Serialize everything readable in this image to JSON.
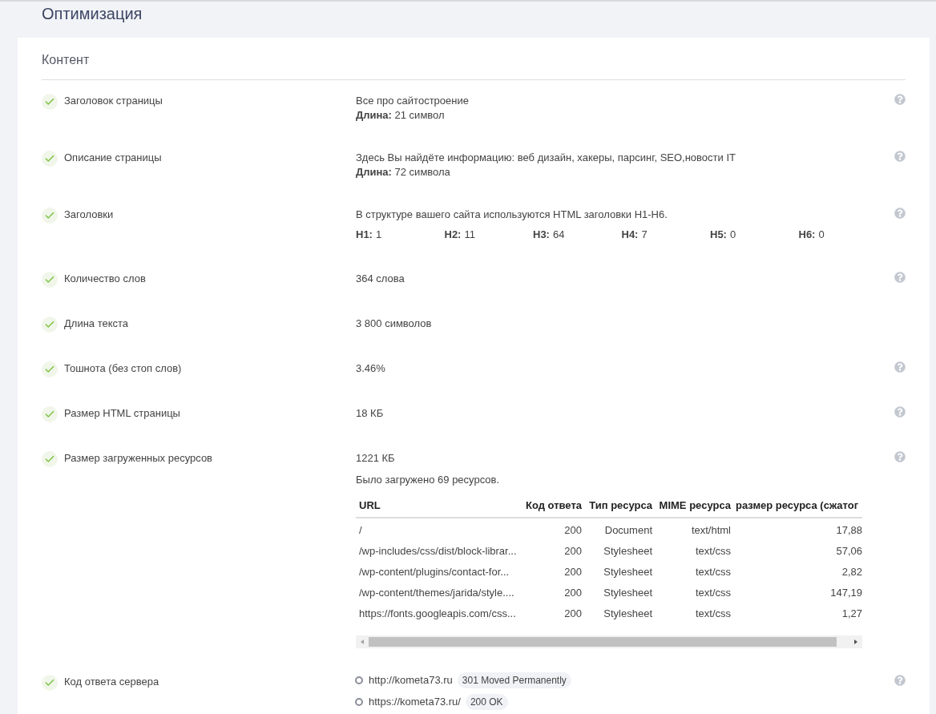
{
  "page_title": "Оптимизация",
  "section": {
    "title": "Контент",
    "rows": [
      {
        "kind": "lines",
        "label": "Заголовок страницы",
        "passed": true,
        "help": true,
        "lines": [
          "Все про сайтостроение",
          "**Длина:** 21 символ"
        ]
      },
      {
        "kind": "lines",
        "label": "Описание страницы",
        "passed": true,
        "help": true,
        "lines": [
          "Здесь Вы найдёте информацию: веб дизайн, хакеры, парсинг, SEO,новости IT",
          "**Длина:** 72 символа"
        ]
      },
      {
        "kind": "headings",
        "label": "Заголовки",
        "passed": true,
        "help": true,
        "text": "В структуре вашего сайта используются HTML заголовки H1-H6.",
        "counts": [
          {
            "tag": "H1:",
            "value": "1"
          },
          {
            "tag": "H2:",
            "value": "11"
          },
          {
            "tag": "H3:",
            "value": "64"
          },
          {
            "tag": "H4:",
            "value": "7"
          },
          {
            "tag": "H5:",
            "value": "0"
          },
          {
            "tag": "H6:",
            "value": "0"
          }
        ]
      },
      {
        "kind": "lines",
        "label": "Количество слов",
        "passed": true,
        "help": true,
        "lines": [
          "364 слова"
        ]
      },
      {
        "kind": "lines",
        "label": "Длина текста",
        "passed": true,
        "help": false,
        "lines": [
          "3 800 символов"
        ]
      },
      {
        "kind": "lines",
        "label": "Тошнота (без стоп слов)",
        "passed": true,
        "help": true,
        "lines": [
          "3.46%"
        ]
      },
      {
        "kind": "lines",
        "label": "Размер HTML страницы",
        "passed": true,
        "help": true,
        "lines": [
          "18 КБ"
        ]
      },
      {
        "kind": "resources",
        "label": "Размер загруженных ресурсов",
        "passed": true,
        "help": true,
        "total": "1221 КБ",
        "note": "Было загружено 69 ресурсов.",
        "table": {
          "columns": [
            "URL",
            "Код ответа",
            "Тип ресурса",
            "MIME ресурса",
            "размер ресурса (сжатог"
          ],
          "rows": [
            [
              "/",
              "200",
              "Document",
              "text/html",
              "17,88"
            ],
            [
              "/wp-includes/css/dist/block-librar...",
              "200",
              "Stylesheet",
              "text/css",
              "57,06"
            ],
            [
              "/wp-content/plugins/contact-for...",
              "200",
              "Stylesheet",
              "text/css",
              "2,82"
            ],
            [
              "/wp-content/themes/jarida/style....",
              "200",
              "Stylesheet",
              "text/css",
              "147,19"
            ],
            [
              "https://fonts.googleapis.com/css...",
              "200",
              "Stylesheet",
              "text/css",
              "1,27"
            ]
          ]
        }
      },
      {
        "kind": "redirects",
        "label": "Код ответа сервера",
        "passed": true,
        "help": true,
        "steps": [
          {
            "url": "http://kometa73.ru",
            "status": "301 Moved Permanently"
          },
          {
            "url": "https://kometa73.ru/",
            "status": "200 OK"
          }
        ]
      }
    ]
  }
}
